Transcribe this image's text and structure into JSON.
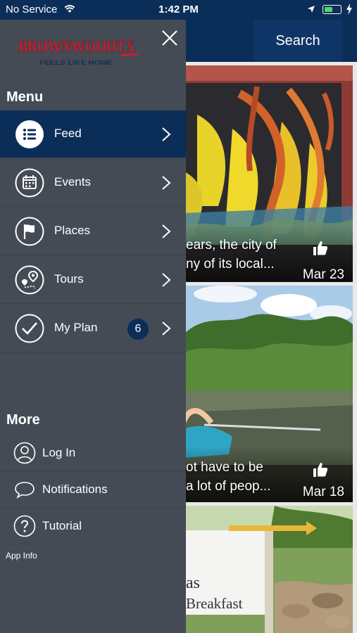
{
  "status_bar": {
    "carrier": "No Service",
    "time": "1:42 PM"
  },
  "header": {
    "search_label": "Search"
  },
  "logo": {
    "name": "BROWNWOODTX",
    "tagline": "FEELS LIKE HOME"
  },
  "menu": {
    "title": "Menu",
    "items": [
      {
        "label": "Feed",
        "icon": "list-icon",
        "active": true
      },
      {
        "label": "Events",
        "icon": "calendar-icon"
      },
      {
        "label": "Places",
        "icon": "flag-icon"
      },
      {
        "label": "Tours",
        "icon": "map-pin-route-icon"
      },
      {
        "label": "My Plan",
        "icon": "checkmark-icon",
        "badge": "6"
      }
    ]
  },
  "more": {
    "title": "More",
    "items": [
      {
        "label": "Log In",
        "icon": "user-icon"
      },
      {
        "label": "Notifications",
        "icon": "chat-bubble-icon"
      },
      {
        "label": "Tutorial",
        "icon": "help-icon"
      }
    ],
    "app_info": "App Info"
  },
  "feed": {
    "cards": [
      {
        "caption_line1": "ears, the city of",
        "caption_line2": "ny of its local...",
        "date": "Mar 23"
      },
      {
        "caption_line1": "ot have to be",
        "caption_line2": "a lot of peop...",
        "date": "Mar 18"
      },
      {
        "sign_line1": "as",
        "sign_line2": "Breakfast"
      }
    ]
  },
  "colors": {
    "navy": "#0b2e59",
    "drawer": "#444b55",
    "logo_red": "#c8202f"
  }
}
